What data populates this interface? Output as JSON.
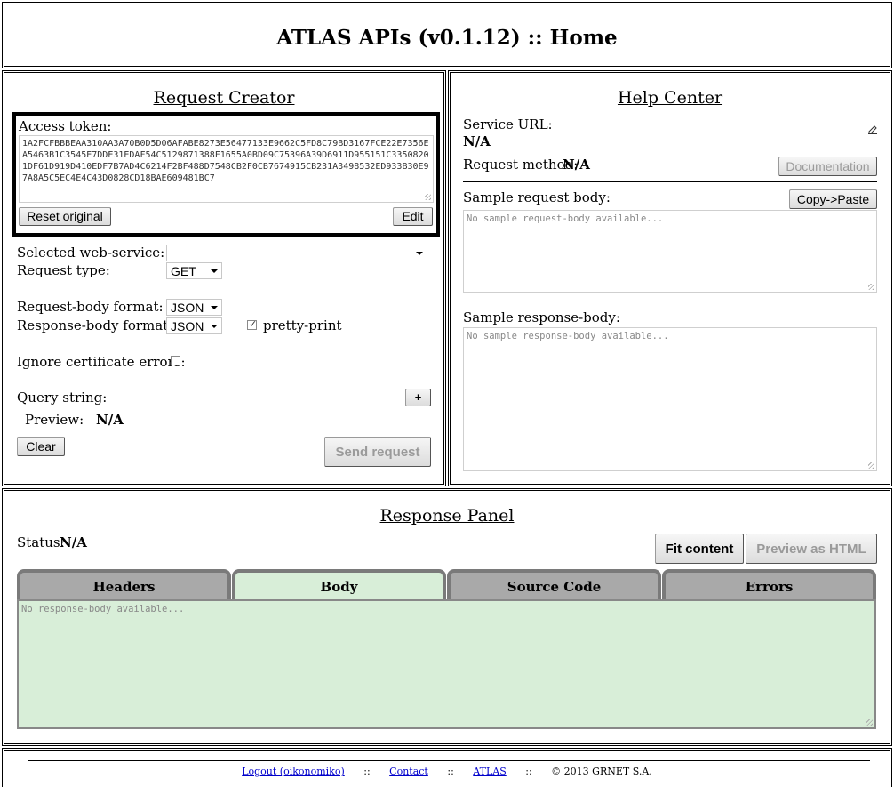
{
  "header": {
    "title": "ATLAS APIs (v0.1.12) :: Home"
  },
  "request_creator": {
    "title": "Request Creator",
    "access_token_label": "Access token:",
    "access_token": "1A2FCFBBBEAA310AA3A70B0D5D06AFABE8273E56477133E9662C5FD8C79BD3167FCE22E7356EA5463B1C3545E7DDE31EDAF54C5129871388F1655A0BD09C75396A39D6911D955151C33508201DF61D919D410EDF7B7AD4C6214F2BF488D7548CB2F0CB7674915CB231A3498532ED933B30E97A8A5C5EC4E4C43D0828CD18BAE609481BC7",
    "reset_label": "Reset original",
    "edit_label": "Edit",
    "selected_service_label": "Selected web-service:",
    "selected_service_value": "",
    "request_type_label": "Request type:",
    "request_type_value": "GET",
    "request_body_format_label": "Request-body format:",
    "request_body_format_value": "JSON",
    "response_body_format_label": "Response-body format:",
    "response_body_format_value": "JSON",
    "pretty_print_label": "pretty-print",
    "pretty_print_checked": true,
    "ignore_cert_label": "Ignore certificate errors:",
    "ignore_cert_checked": false,
    "query_string_label": "Query string:",
    "add_label": "+",
    "preview_label": "Preview:",
    "preview_value": "N/A",
    "clear_label": "Clear",
    "send_label": "Send request"
  },
  "help_center": {
    "title": "Help Center",
    "service_url_label": "Service URL:",
    "service_url_value": "N/A",
    "request_method_label": "Request method:",
    "request_method_value": "N/A",
    "documentation_label": "Documentation",
    "sample_request_label": "Sample request body:",
    "copy_paste_label": "Copy->Paste",
    "sample_request_placeholder": "No sample request-body available...",
    "sample_response_label": "Sample response-body:",
    "sample_response_placeholder": "No sample response-body available..."
  },
  "response_panel": {
    "title": "Response Panel",
    "status_label": "Status:",
    "status_value": "N/A",
    "fit_content_label": "Fit content",
    "preview_html_label": "Preview as HTML",
    "tabs": [
      {
        "label": "Headers"
      },
      {
        "label": "Body"
      },
      {
        "label": "Source Code"
      },
      {
        "label": "Errors"
      }
    ],
    "active_tab": "Body",
    "body_placeholder": "No response-body available..."
  },
  "footer": {
    "logout_label": "Logout (oikonomiko)",
    "contact_label": "Contact",
    "atlas_label": "ATLAS",
    "copyright": "© 2013 GRNET S.A.",
    "separator": "::"
  },
  "colors": {
    "active_tab_bg": "#d8eed8",
    "inactive_tab_bg": "#a9a9a9",
    "link": "#0000cc"
  },
  "icons": {
    "corner_icon": "edit-pencil-icon"
  }
}
